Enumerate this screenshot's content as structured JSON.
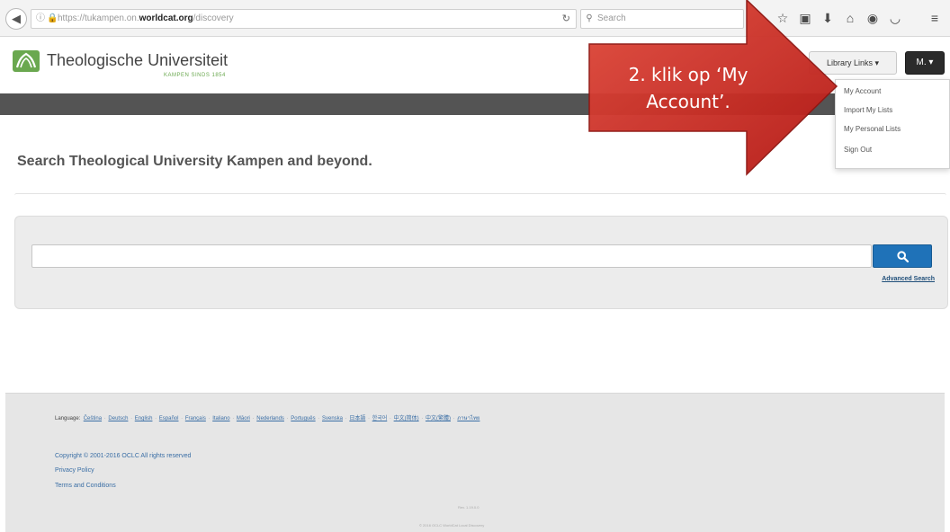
{
  "browser": {
    "url_prefix": "https://tukampen.on.",
    "url_domain": "worldcat.org",
    "url_path": "/discovery",
    "search_placeholder": "Search"
  },
  "header": {
    "logo_text": "Theologische Universiteit",
    "logo_subtext": "KAMPEN SINDS 1854",
    "library_links_label": "Library Links ▾",
    "user_label": "M. ▾"
  },
  "dropdown": {
    "items": [
      "My Account",
      "Import My Lists",
      "My Personal Lists",
      "Sign Out"
    ]
  },
  "hero": {
    "title": "Search Theological University Kampen and beyond."
  },
  "search": {
    "input_value": "",
    "advanced_link": "Advanced Search"
  },
  "footer": {
    "language_label": "Language:",
    "languages": [
      "Čeština",
      "Deutsch",
      "English",
      "Español",
      "Français",
      "Italiano",
      "Māori",
      "Nederlands",
      "Português",
      "Svenska",
      "日本語",
      "한국어",
      "中文(简体)",
      "中文(繁體)",
      "ภาษาไทย"
    ],
    "copyright": "Copyright © 2001-2016 OCLC All rights reserved",
    "privacy": "Privacy Policy",
    "terms": "Terms and Conditions",
    "version1": "Rev. 1.19.0.0",
    "version2": "© 2016 OCLC WorldCat Local Discovery"
  },
  "callout": {
    "text": "2. klik op ‘My Account’.",
    "color": "#c0201c"
  },
  "colors": {
    "accent_blue": "#1f72b8",
    "dark_bar": "#545454",
    "logo_green": "#6aa84f"
  }
}
